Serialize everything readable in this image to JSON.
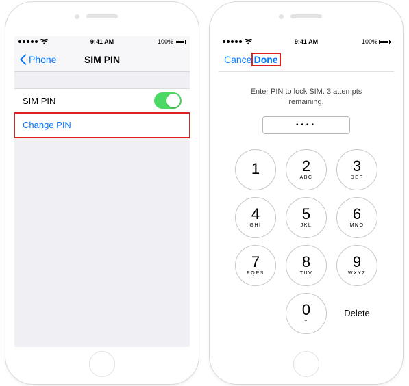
{
  "status": {
    "time": "9:41 AM",
    "battery": "100%"
  },
  "left": {
    "back_label": "Phone",
    "title": "SIM PIN",
    "sim_pin_label": "SIM PIN",
    "change_pin_label": "Change PIN",
    "toggle_on": true
  },
  "right": {
    "cancel_label": "Cancel",
    "done_label": "Done",
    "prompt": "Enter PIN to lock SIM. 3 attempts remaining.",
    "entered": "••••",
    "delete_label": "Delete",
    "keys": [
      {
        "digit": "1",
        "letters": ""
      },
      {
        "digit": "2",
        "letters": "ABC"
      },
      {
        "digit": "3",
        "letters": "DEF"
      },
      {
        "digit": "4",
        "letters": "GHI"
      },
      {
        "digit": "5",
        "letters": "JKL"
      },
      {
        "digit": "6",
        "letters": "MNO"
      },
      {
        "digit": "7",
        "letters": "PQRS"
      },
      {
        "digit": "8",
        "letters": "TUV"
      },
      {
        "digit": "9",
        "letters": "WXYZ"
      },
      {
        "digit": "0",
        "letters": "+"
      }
    ]
  }
}
